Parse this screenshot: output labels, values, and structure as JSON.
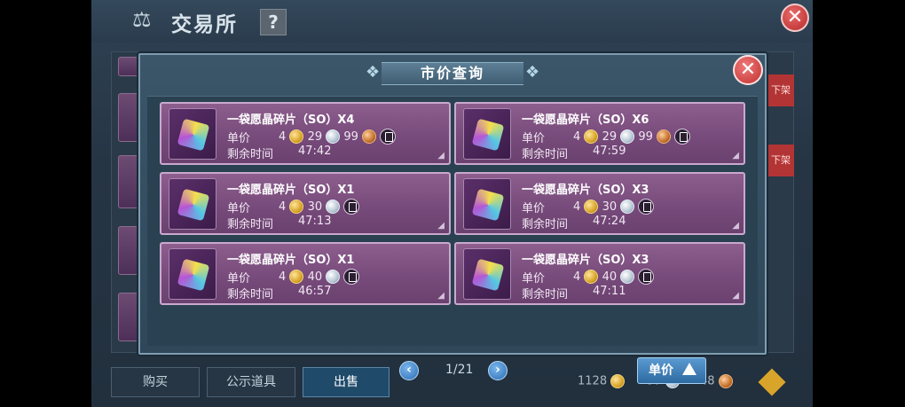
{
  "background": {
    "title": "交易所",
    "help_label": "?",
    "close_label": "✕",
    "off_shelf_label": "下架",
    "tabs": [
      {
        "label": "购买",
        "active": false
      },
      {
        "label": "公示道具",
        "active": false
      },
      {
        "label": "出售",
        "active": true
      }
    ],
    "currency": {
      "gold": "1128",
      "silver": "97",
      "copper": "48"
    }
  },
  "modal": {
    "title": "市价查询",
    "close_label": "✕",
    "price_label": "单价",
    "time_label": "剩余时间",
    "listings": [
      {
        "name": "一袋愿晶碎片（SO）X4",
        "gold": "4",
        "silver": "29",
        "copper": "99",
        "time": "47:42"
      },
      {
        "name": "一袋愿晶碎片（SO）X6",
        "gold": "4",
        "silver": "29",
        "copper": "99",
        "time": "47:59"
      },
      {
        "name": "一袋愿晶碎片（SO）X1",
        "gold": "4",
        "silver": "30",
        "copper": "",
        "time": "47:13"
      },
      {
        "name": "一袋愿晶碎片（SO）X3",
        "gold": "4",
        "silver": "30",
        "copper": "",
        "time": "47:24"
      },
      {
        "name": "一袋愿晶碎片（SO）X1",
        "gold": "4",
        "silver": "40",
        "copper": "",
        "time": "46:57"
      },
      {
        "name": "一袋愿晶碎片（SO）X3",
        "gold": "4",
        "silver": "40",
        "copper": "",
        "time": "47:11"
      }
    ],
    "pagination": {
      "label": "1/21"
    },
    "sort_button_label": "单价"
  },
  "icons": {
    "title": "scale-icon",
    "gold": "gold-coin-icon",
    "silver": "silver-coin-icon",
    "copper": "copper-coin-icon",
    "copy": "copy-icon",
    "prev": "chevron-left-icon",
    "next": "chevron-right-icon",
    "sort": "arrow-up-icon"
  }
}
